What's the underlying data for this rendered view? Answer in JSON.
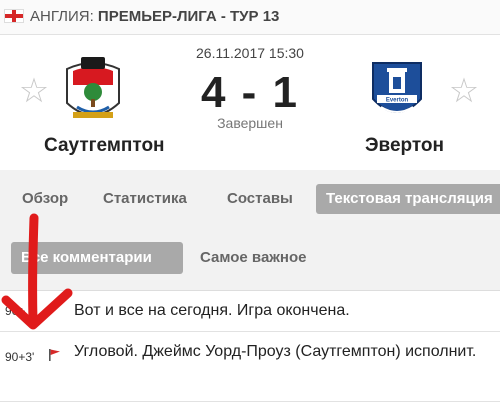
{
  "breadcrumb": {
    "country": "АНГЛИЯ:",
    "league": "ПРЕМЬЕР-ЛИГА - ТУР 13"
  },
  "match": {
    "date": "26.11.2017 15:30",
    "score": "4 - 1",
    "status": "Завершен",
    "home_team": "Саутгемптон",
    "away_team": "Эвертон"
  },
  "tabs": [
    {
      "label": "Обзор"
    },
    {
      "label": "Статистика"
    },
    {
      "label": "Составы"
    },
    {
      "label": "Текстовая трансляция"
    }
  ],
  "filters": {
    "all": "Все комментарии",
    "important": "Самое важное"
  },
  "comments": [
    {
      "minute": "90+",
      "text": "Вот и все на сегодня. Игра окончена."
    },
    {
      "minute": "90+3'",
      "text": "Угловой. Джеймс Уорд-Проуз (Саутгемптон) исполнит."
    }
  ],
  "colors": {
    "accent": "#a9a9a9",
    "annotation": "#e01b1b",
    "corner_flag": "#d62828"
  },
  "icons": {
    "favorite": "star-icon",
    "corner": "corner-flag-icon",
    "country": "england-flag-icon"
  }
}
